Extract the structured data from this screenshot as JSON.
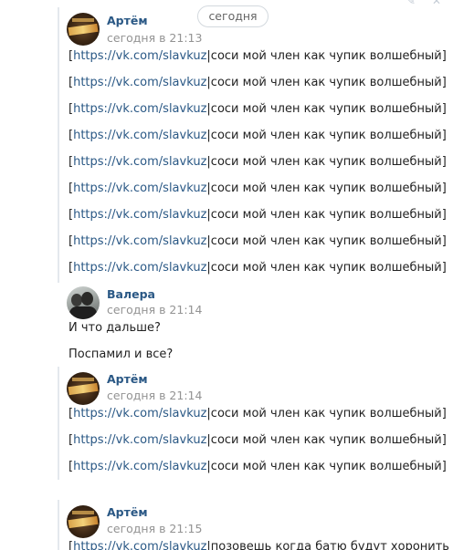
{
  "top_cut_text": "",
  "date_separator": "сегодня",
  "groups": [
    {
      "author": "Артём",
      "time": "сегодня в 21:13",
      "lines": [
        {
          "open": "[",
          "link": "https://vk.com/slavkuz",
          "text": "|соси мой член как чупик волшебный]"
        },
        {
          "open": "[",
          "link": "https://vk.com/slavkuz",
          "text": "|соси мой член как чупик волшебный]"
        },
        {
          "open": "[",
          "link": "https://vk.com/slavkuz",
          "text": "|соси мой член как чупик волшебный]"
        },
        {
          "open": "[",
          "link": "https://vk.com/slavkuz",
          "text": "|соси мой член как чупик волшебный]"
        },
        {
          "open": "[",
          "link": "https://vk.com/slavkuz",
          "text": "|соси мой член как чупик волшебный]"
        },
        {
          "open": "[",
          "link": "https://vk.com/slavkuz",
          "text": "|соси мой член как чупик волшебный]"
        },
        {
          "open": "[",
          "link": "https://vk.com/slavkuz",
          "text": "|соси мой член как чупик волшебный]"
        },
        {
          "open": "[",
          "link": "https://vk.com/slavkuz",
          "text": "|соси мой член как чупик волшебный]"
        },
        {
          "open": "[",
          "link": "https://vk.com/slavkuz",
          "text": "|соси мой член как чупик волшебный]"
        }
      ]
    },
    {
      "author": "Валера",
      "time": "сегодня в 21:14",
      "lines": [
        {
          "text": "И что дальше?"
        },
        {
          "text": "Поспамил и все?"
        }
      ]
    },
    {
      "author": "Артём",
      "time": "сегодня в 21:14",
      "lines": [
        {
          "open": "[",
          "link": "https://vk.com/slavkuz",
          "text": "|соси мой член как чупик волшебный]"
        },
        {
          "open": "[",
          "link": "https://vk.com/slavkuz",
          "text": "|соси мой член как чупик волшебный]"
        },
        {
          "open": "[",
          "link": "https://vk.com/slavkuz",
          "text": "|соси мой член как чупик волшебный]"
        }
      ]
    },
    {
      "author": "Артём",
      "time": "сегодня в 21:15",
      "lines": [
        {
          "open": "[",
          "link": "https://vk.com/slavkuz",
          "text": "|позовешь когда батю будут хоронить"
        }
      ]
    }
  ],
  "icons": [
    "reply-icon",
    "more-icon"
  ]
}
